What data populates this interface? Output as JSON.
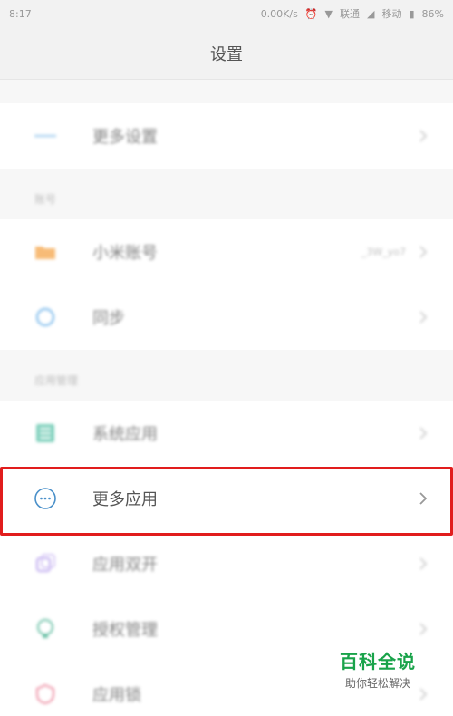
{
  "status_bar": {
    "time": "8:17",
    "speed": "0.00K/s",
    "carrier1": "联通",
    "carrier2": "移动",
    "battery": "86%"
  },
  "header": {
    "title": "设置"
  },
  "sections": {
    "top": {
      "items": [
        {
          "label": "更多设置"
        }
      ]
    },
    "account": {
      "title": "账号",
      "items": [
        {
          "label": "小米账号",
          "value": "_3W_yo7"
        },
        {
          "label": "同步"
        }
      ]
    },
    "apps": {
      "title": "应用管理",
      "items": [
        {
          "label": "系统应用"
        },
        {
          "label": "更多应用"
        },
        {
          "label": "应用双开"
        },
        {
          "label": "授权管理"
        },
        {
          "label": "应用锁"
        }
      ]
    }
  },
  "colors": {
    "highlight": "#e11d1d",
    "brand_green": "#19a34a"
  },
  "watermark": {
    "brand": "百科全说",
    "slogan": "助你轻松解决"
  }
}
